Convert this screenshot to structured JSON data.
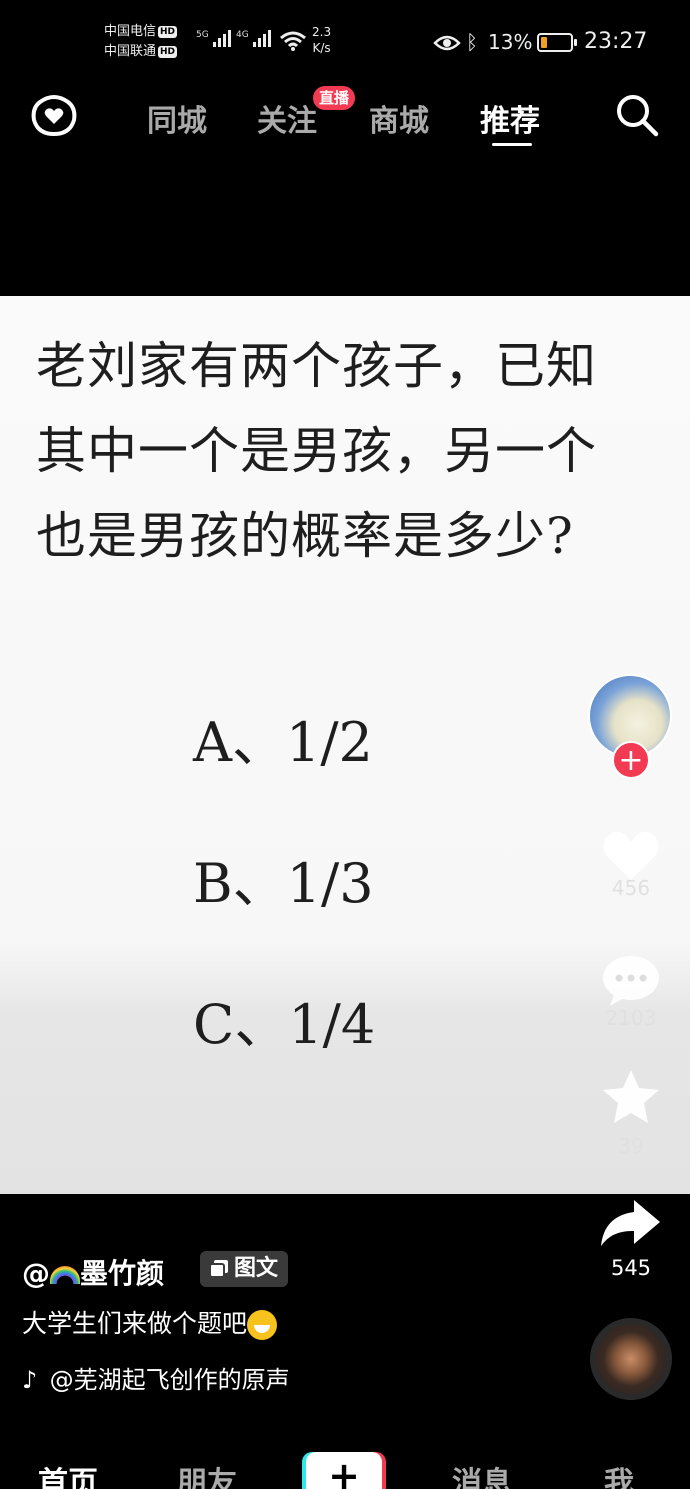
{
  "status_bar": {
    "carrier_1": "中国电信",
    "carrier_2": "中国联通",
    "hd": "HD",
    "net_1": "5G",
    "net_2": "4G",
    "speed_value": "2.3",
    "speed_unit": "K/s",
    "battery_percent": "13%",
    "time": "23:27"
  },
  "top_nav": {
    "tabs": [
      {
        "label": "同城",
        "active": false
      },
      {
        "label": "关注",
        "active": false
      },
      {
        "label": "商城",
        "active": false
      },
      {
        "label": "推荐",
        "active": true
      }
    ],
    "live_badge": "直播"
  },
  "content": {
    "question_lines": [
      "老刘家有两个孩子，已知",
      "其中一个是男孩，另一个",
      "也是男孩的概率是多少?"
    ],
    "options": [
      "A、1/2",
      "B、1/3",
      "C、1/4"
    ]
  },
  "right_rail": {
    "likes": "456",
    "comments": "2103",
    "favorites": "39",
    "shares": "545",
    "follow": "+"
  },
  "post": {
    "author": "@🌈墨竹颜",
    "author_prefix": "@",
    "author_name": "墨竹颜",
    "tag": "图文",
    "caption": "大学生们来做个题吧",
    "music": "@芜湖起飞创作的原声"
  },
  "bottom_nav": {
    "items": [
      {
        "label": "首页",
        "active": true
      },
      {
        "label": "朋友",
        "active": false
      },
      {
        "label": "+",
        "active": false
      },
      {
        "label": "消息",
        "active": false
      },
      {
        "label": "我",
        "active": false
      }
    ]
  },
  "colors": {
    "accent_red": "#f23a53",
    "background": "#000000",
    "content_bg": "#fafafa"
  }
}
